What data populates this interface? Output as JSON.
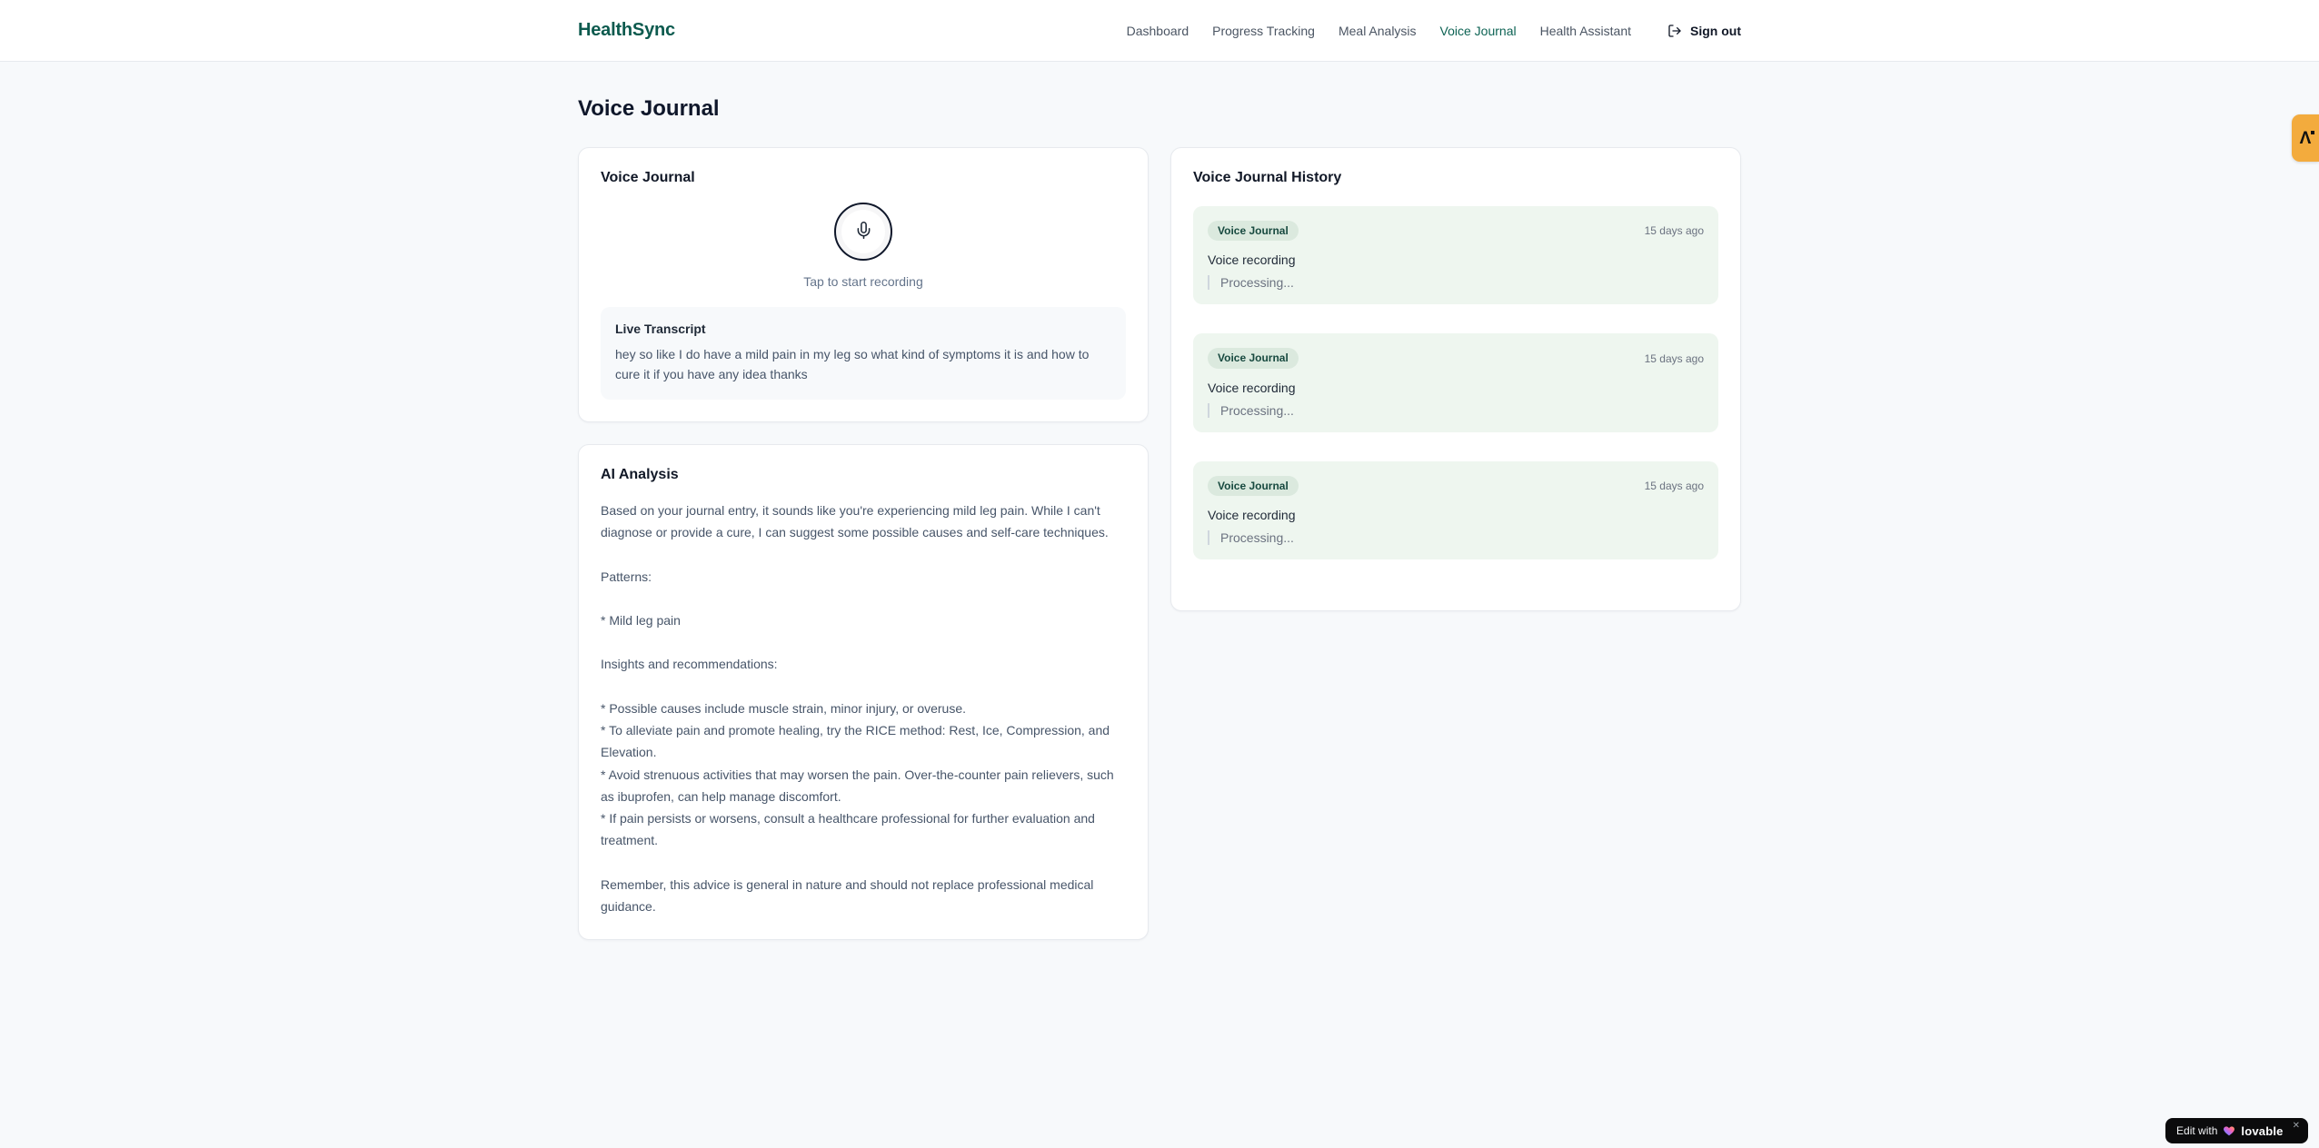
{
  "header": {
    "logo": "HealthSync",
    "nav": [
      {
        "label": "Dashboard"
      },
      {
        "label": "Progress Tracking"
      },
      {
        "label": "Meal Analysis"
      },
      {
        "label": "Voice Journal"
      },
      {
        "label": "Health Assistant"
      }
    ],
    "sign_out_label": "Sign out"
  },
  "page": {
    "title": "Voice Journal"
  },
  "recorder": {
    "card_title": "Voice Journal",
    "tap_hint": "Tap to start recording",
    "transcript_title": "Live Transcript",
    "transcript_text": "hey so like I do have a mild pain in my leg so what kind of symptoms it is and how to cure it if you have any idea thanks"
  },
  "analysis": {
    "card_title": "AI Analysis",
    "body": "Based on your journal entry, it sounds like you're experiencing mild leg pain. While I can't diagnose or provide a cure, I can suggest some possible causes and self-care techniques.\n\nPatterns:\n\n* Mild leg pain\n\nInsights and recommendations:\n\n* Possible causes include muscle strain, minor injury, or overuse.\n* To alleviate pain and promote healing, try the RICE method: Rest, Ice, Compression, and Elevation.\n* Avoid strenuous activities that may worsen the pain. Over-the-counter pain relievers, such as ibuprofen, can help manage discomfort.\n* If pain persists or worsens, consult a healthcare professional for further evaluation and treatment.\n\nRemember, this advice is general in nature and should not replace professional medical guidance."
  },
  "history": {
    "card_title": "Voice Journal History",
    "entries": [
      {
        "badge": "Voice Journal",
        "time": "15 days ago",
        "title": "Voice recording",
        "status": "Processing..."
      },
      {
        "badge": "Voice Journal",
        "time": "15 days ago",
        "title": "Voice recording",
        "status": "Processing..."
      },
      {
        "badge": "Voice Journal",
        "time": "15 days ago",
        "title": "Voice recording",
        "status": "Processing..."
      }
    ]
  },
  "widgets": {
    "side_tab": {
      "glyph": "Λ"
    },
    "edit_badge": {
      "prefix": "Edit with",
      "brand": "lovable",
      "close": "✕"
    }
  },
  "colors": {
    "brand_teal": "#0c5a4e",
    "nav_active": "#0d6354",
    "page_bg": "#f7f9fb",
    "entry_bg": "#eef6ef",
    "badge_bg": "#dbe9de",
    "side_tab_amber": "#f3ab3d"
  }
}
